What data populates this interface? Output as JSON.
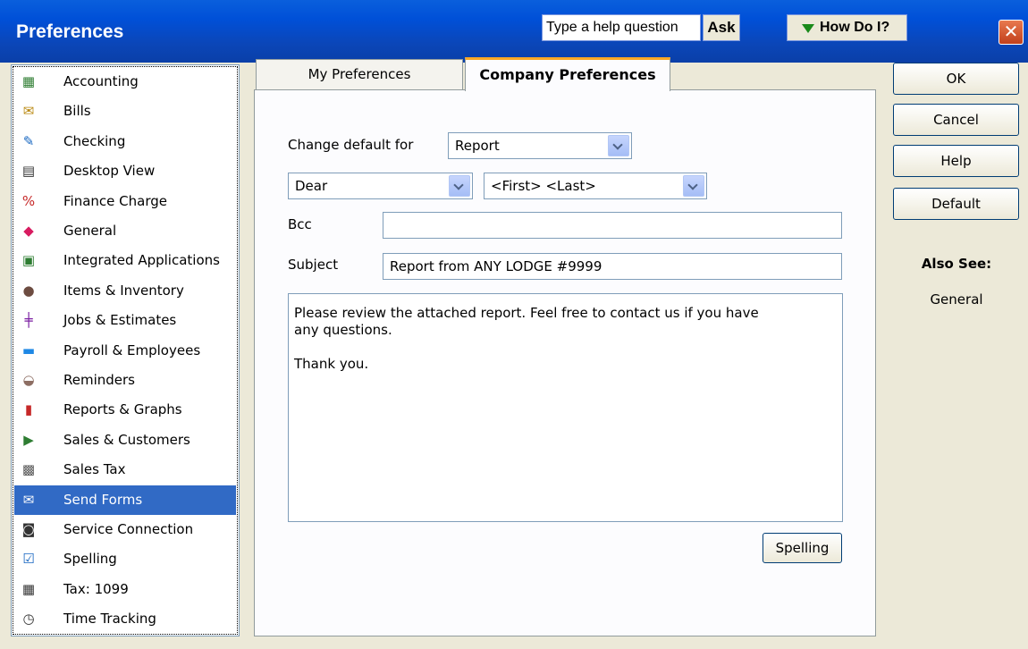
{
  "window": {
    "title": "Preferences",
    "help_placeholder": "Type a help question",
    "ask_label": "Ask",
    "howdoi_label": "How Do I?",
    "close_label": "✕"
  },
  "categories": [
    {
      "label": "Accounting",
      "icon": "accounting-icon",
      "glyph": "▦",
      "color": "#2e7d32"
    },
    {
      "label": "Bills",
      "icon": "bills-icon",
      "glyph": "✉",
      "color": "#b8860b"
    },
    {
      "label": "Checking",
      "icon": "checking-icon",
      "glyph": "✎",
      "color": "#1565c0"
    },
    {
      "label": "Desktop View",
      "icon": "desktop-view-icon",
      "glyph": "▤",
      "color": "#333333"
    },
    {
      "label": "Finance Charge",
      "icon": "finance-charge-icon",
      "glyph": "%",
      "color": "#c62828"
    },
    {
      "label": "General",
      "icon": "general-icon",
      "glyph": "◆",
      "color": "#d81b60"
    },
    {
      "label": "Integrated Applications",
      "icon": "integrated-applications-icon",
      "glyph": "▣",
      "color": "#2e7d32"
    },
    {
      "label": "Items & Inventory",
      "icon": "items-inventory-icon",
      "glyph": "●",
      "color": "#6d4c41"
    },
    {
      "label": "Jobs & Estimates",
      "icon": "jobs-estimates-icon",
      "glyph": "╪",
      "color": "#7b1fa2"
    },
    {
      "label": "Payroll & Employees",
      "icon": "payroll-employees-icon",
      "glyph": "▬",
      "color": "#1e88e5"
    },
    {
      "label": "Reminders",
      "icon": "reminders-icon",
      "glyph": "◒",
      "color": "#8d6e63"
    },
    {
      "label": "Reports & Graphs",
      "icon": "reports-graphs-icon",
      "glyph": "▮",
      "color": "#c62828"
    },
    {
      "label": "Sales & Customers",
      "icon": "sales-customers-icon",
      "glyph": "▶",
      "color": "#2e7d32"
    },
    {
      "label": "Sales Tax",
      "icon": "sales-tax-icon",
      "glyph": "▩",
      "color": "#555555"
    },
    {
      "label": "Send Forms",
      "icon": "send-forms-icon",
      "glyph": "✉",
      "color": "#ffffff"
    },
    {
      "label": "Service Connection",
      "icon": "service-connection-icon",
      "glyph": "◙",
      "color": "#333333"
    },
    {
      "label": "Spelling",
      "icon": "spelling-icon",
      "glyph": "☑",
      "color": "#1565c0"
    },
    {
      "label": "Tax: 1099",
      "icon": "tax-1099-icon",
      "glyph": "▦",
      "color": "#333333"
    },
    {
      "label": "Time Tracking",
      "icon": "time-tracking-icon",
      "glyph": "◷",
      "color": "#333333"
    }
  ],
  "selected_category": "Send Forms",
  "tabs": {
    "my": "My Preferences",
    "company": "Company Preferences"
  },
  "form": {
    "change_default_label": "Change default for",
    "change_default_value": "Report",
    "salutation_value": "Dear",
    "name_format_value": "<First> <Last>",
    "bcc_label": "Bcc",
    "bcc_value": "",
    "subject_label": "Subject",
    "subject_value": "Report from ANY LODGE #9999",
    "body_lines": [
      "Please review the attached report.  Feel free to contact us if you have",
      "any questions.",
      "",
      "Thank you."
    ],
    "spelling_button": "Spelling"
  },
  "buttons": {
    "ok": "OK",
    "cancel": "Cancel",
    "help": "Help",
    "default": "Default"
  },
  "also_see": {
    "heading": "Also See:",
    "link": "General"
  }
}
